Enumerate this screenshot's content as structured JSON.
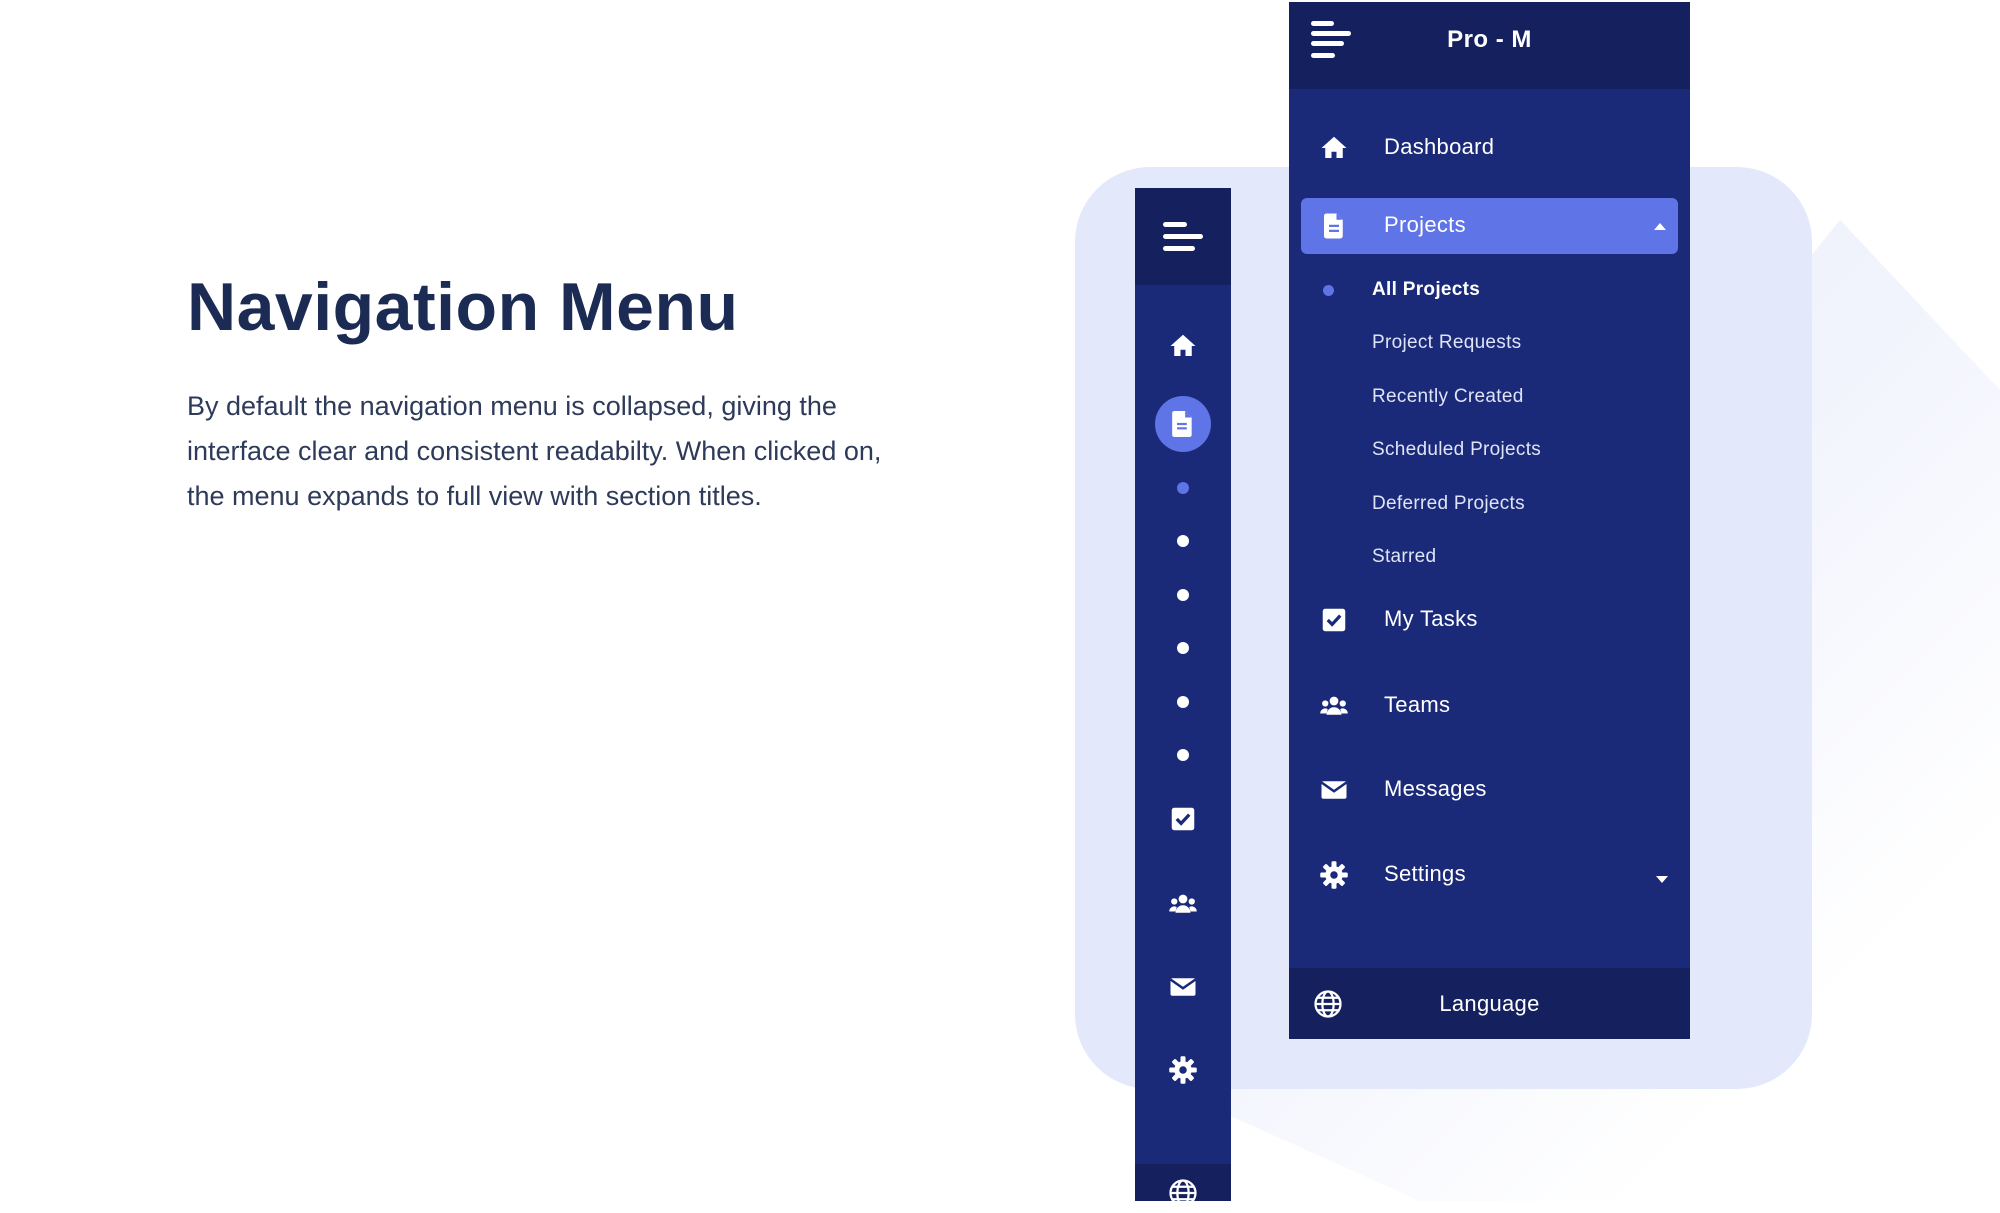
{
  "intro": {
    "title": "Navigation Menu",
    "description": "By default the navigation menu is collapsed, giving the interface clear and consistent readabilty. When clicked on, the menu expands to full view with section titles."
  },
  "colors": {
    "navy": "#1b2a78",
    "navy_dark": "#15215f",
    "accent": "#5f74e6",
    "backdrop": "#e3e8fb",
    "heading": "#1c2b53"
  },
  "collapsed_nav": {
    "icons": [
      "menu-icon",
      "home-icon",
      "document-icon",
      "check-square-icon",
      "users-icon",
      "mail-icon",
      "gear-icon",
      "globe-icon"
    ],
    "active_item": "document-icon"
  },
  "expanded_nav": {
    "app_title": "Pro - M",
    "items": {
      "dashboard": {
        "label": "Dashboard",
        "icon": "home-icon"
      },
      "projects": {
        "label": "Projects",
        "icon": "document-icon",
        "expanded": true,
        "children": [
          "All Projects",
          "Project Requests",
          "Recently Created",
          "Scheduled Projects",
          "Deferred Projects",
          "Starred"
        ],
        "current_child": "All Projects"
      },
      "my_tasks": {
        "label": "My Tasks",
        "icon": "check-square-icon"
      },
      "teams": {
        "label": "Teams",
        "icon": "users-icon"
      },
      "messages": {
        "label": "Messages",
        "icon": "mail-icon"
      },
      "settings": {
        "label": "Settings",
        "icon": "gear-icon",
        "expanded": false
      }
    },
    "footer": {
      "label": "Language",
      "icon": "globe-icon"
    }
  }
}
